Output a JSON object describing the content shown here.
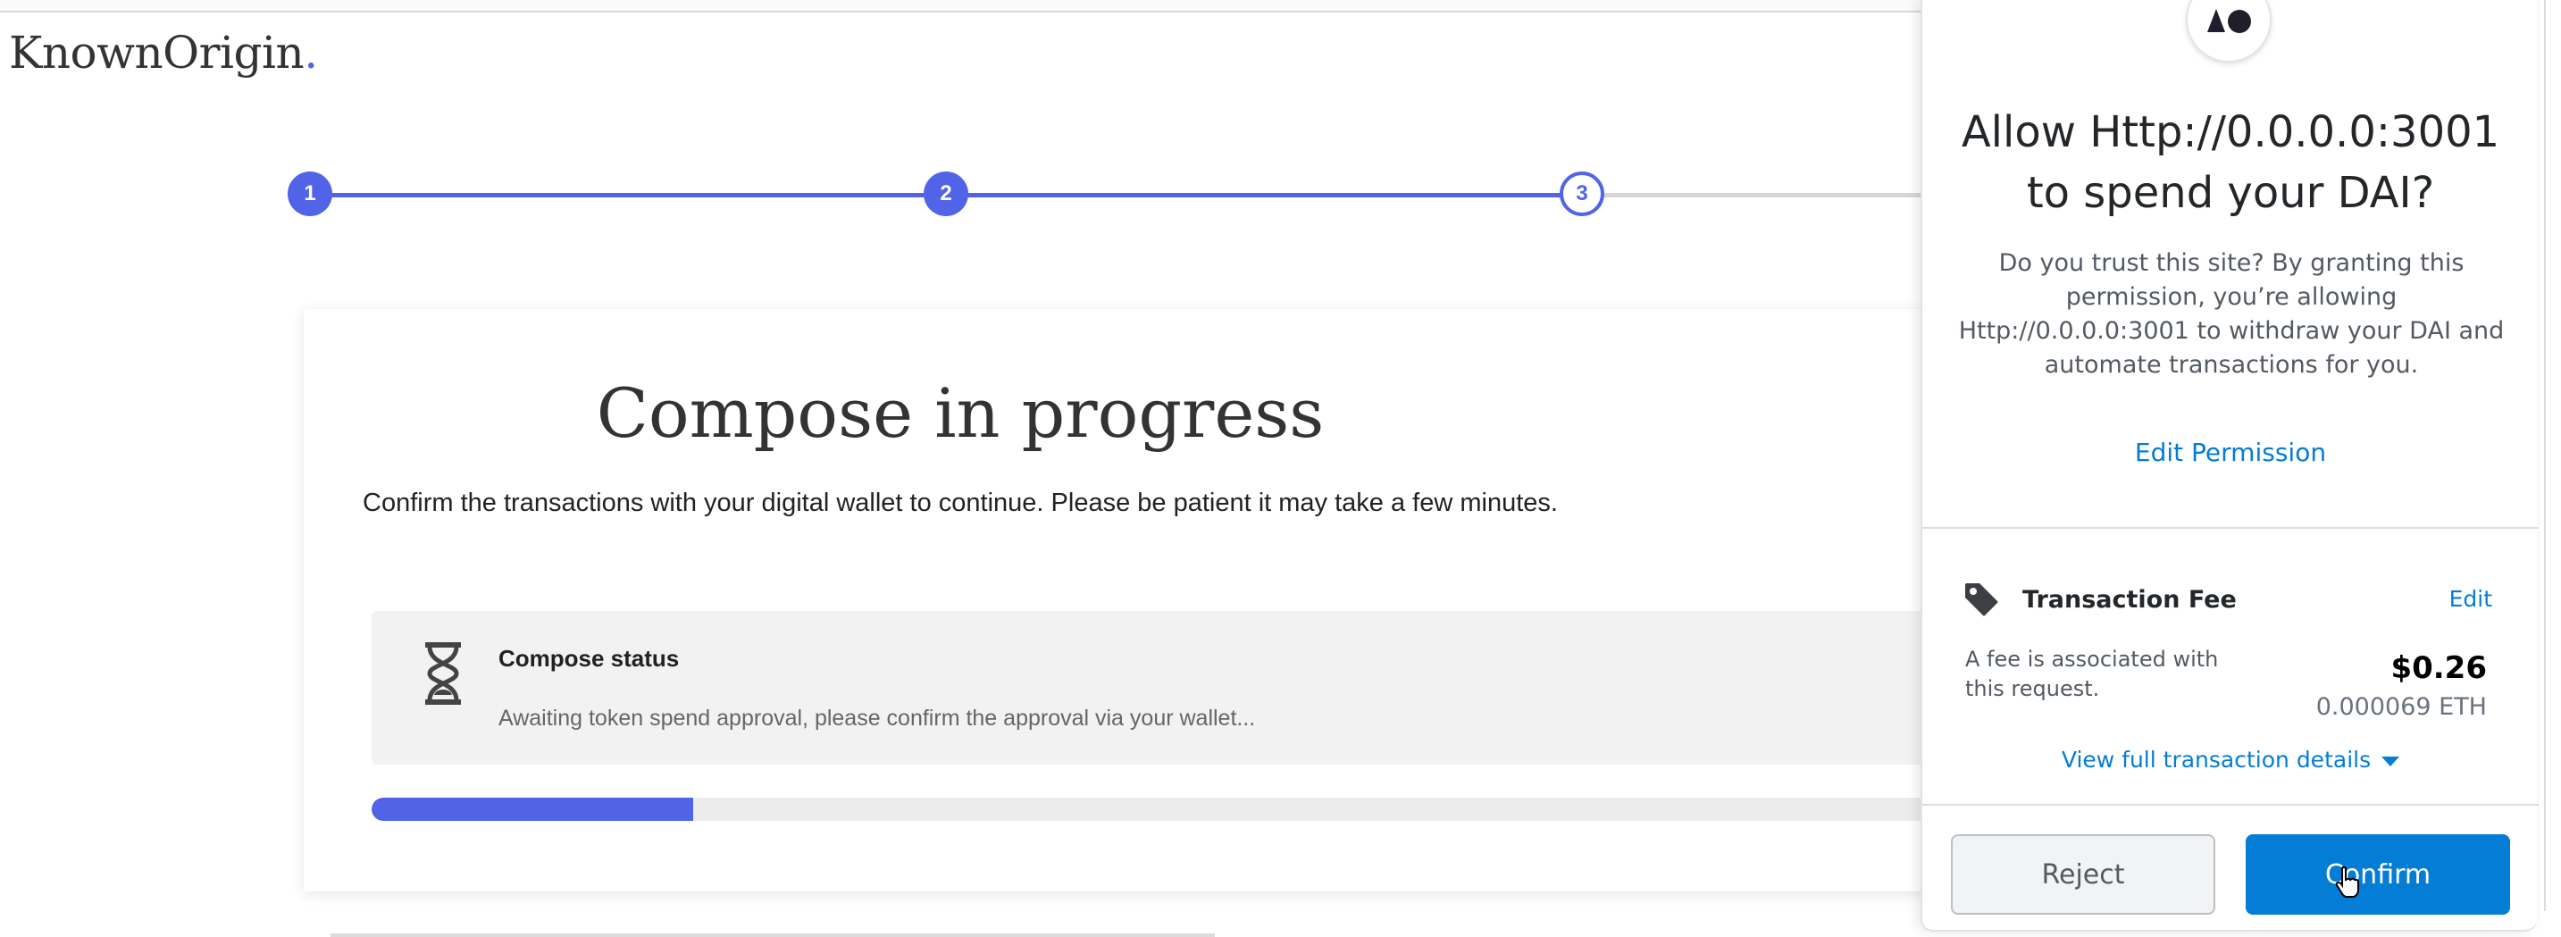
{
  "app": {
    "logo_text": "KnownOrigin",
    "logo_dot": "."
  },
  "stepper": {
    "steps": [
      {
        "label": "1",
        "state": "completed"
      },
      {
        "label": "2",
        "state": "completed"
      },
      {
        "label": "3",
        "state": "current"
      }
    ],
    "accent_color": "#5164e8"
  },
  "compose": {
    "title": "Compose in progress",
    "subtitle": "Confirm the transactions with your digital wallet to continue. Please be patient it may take a few minutes.",
    "status_title": "Compose status",
    "status_message": "Awaiting token spend approval, please confirm the approval via your wallet...",
    "status_icon": "hourglass-icon",
    "progress_percent": 20
  },
  "wallet_popup": {
    "site_icon": "site-logo-icon",
    "title_line1": "Allow Http://0.0.0.0:3001",
    "title_line2": "to spend your DAI?",
    "description": "Do you trust this site? By granting this permission, you’re allowing Http://0.0.0.0:3001 to withdraw your DAI and automate transactions for you.",
    "edit_permission_label": "Edit Permission",
    "fee": {
      "icon": "tag-icon",
      "title": "Transaction Fee",
      "edit_label": "Edit",
      "note": "A fee is associated with this request.",
      "amount_usd": "$0.26",
      "amount_eth": "0.000069 ETH"
    },
    "view_details_label": "View full transaction details",
    "reject_label": "Reject",
    "confirm_label": "Confirm",
    "link_color": "#037dd6"
  }
}
